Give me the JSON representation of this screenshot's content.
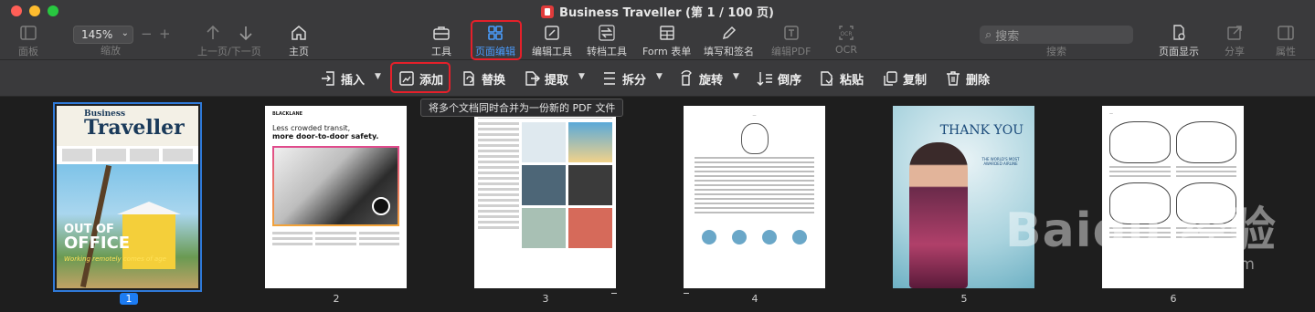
{
  "window": {
    "title": "Business Traveller (第 1 / 100 页)"
  },
  "toolbar": {
    "sidebar": "面板",
    "zoom_value": "145%",
    "zoom_label": "缩放",
    "nav": "上一页/下一页",
    "home": "主页",
    "tools": "工具",
    "page_edit": "页面编辑",
    "edit_tool": "编辑工具",
    "convert_tool": "转档工具",
    "form": "Form 表单",
    "fill_sign": "填写和签名",
    "edit_pdf": "编辑PDF",
    "ocr": "OCR",
    "search_placeholder": "搜索",
    "search_label": "搜索",
    "page_display": "页面显示",
    "share": "分享",
    "properties": "属性"
  },
  "subbar": {
    "insert": "插入",
    "add": "添加",
    "replace": "替换",
    "extract": "提取",
    "split": "拆分",
    "rotate": "旋转",
    "reverse": "倒序",
    "paste": "粘贴",
    "copy": "复制",
    "delete": "删除"
  },
  "tooltip": "将多个文档同时合并为一份新的 PDF 文件",
  "pages": [
    {
      "number": "1"
    },
    {
      "number": "2"
    },
    {
      "number": "3"
    },
    {
      "number": "4"
    },
    {
      "number": "5"
    },
    {
      "number": "6"
    }
  ],
  "thumbs": {
    "p1_logo_a": "Business",
    "p1_logo_b": "Traveller",
    "p1_out": "OUT OF",
    "p1_office": "OFFICE",
    "p1_sub": "Working remotely comes of age",
    "p2_brand": "BLACKLANE",
    "p2_h1": "Less crowded transit,",
    "p2_h2": "more door-to-door safety.",
    "p5_thank": "THANK YOU",
    "p5_small": "THE WORLD'S MOST AWARDED AIRLINE"
  },
  "watermark": {
    "main": "Baidu 经验",
    "sub": "jingyan.baidu.com"
  },
  "colors": {
    "accent": "#4a9dff",
    "highlight_frame": "#e5202a",
    "selection": "#1d7cf2"
  }
}
